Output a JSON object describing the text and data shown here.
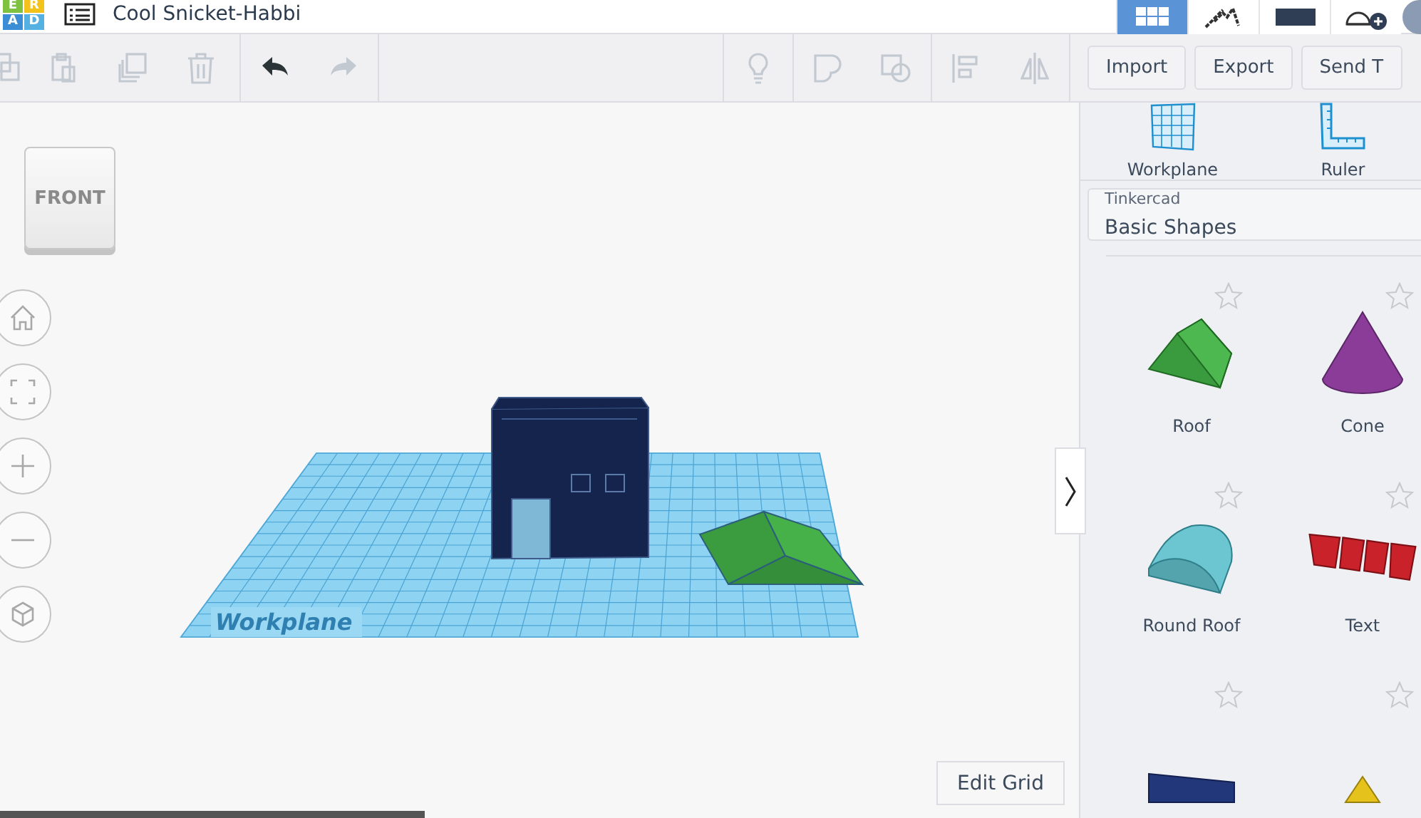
{
  "logo": {
    "letters": [
      "E",
      "R",
      "A",
      "D"
    ]
  },
  "design": {
    "title": "Cool Snicket-Habbi"
  },
  "view_modes": [
    {
      "kind": "grid",
      "selected": true
    },
    {
      "kind": "blocks",
      "selected": false
    },
    {
      "kind": "bricks",
      "selected": false
    },
    {
      "kind": "share",
      "selected": false
    }
  ],
  "toolbar": {
    "left": [
      {
        "kind": "copy",
        "disabled": true
      },
      {
        "kind": "paste",
        "disabled": true
      },
      {
        "kind": "duplicate",
        "disabled": true
      },
      {
        "kind": "delete",
        "disabled": true
      },
      {
        "kind": "undo",
        "disabled": false
      },
      {
        "kind": "redo",
        "disabled": true
      }
    ],
    "right": [
      {
        "kind": "bulb",
        "disabled": true
      },
      {
        "kind": "group",
        "disabled": true
      },
      {
        "kind": "ungroup",
        "disabled": true
      },
      {
        "kind": "align",
        "disabled": true
      },
      {
        "kind": "mirror",
        "disabled": true
      }
    ],
    "buttons": [
      "Import",
      "Export",
      "Send T"
    ]
  },
  "viewcube": {
    "face": "FRONT"
  },
  "nav": [
    {
      "kind": "home"
    },
    {
      "kind": "fit"
    },
    {
      "kind": "zoom_in"
    },
    {
      "kind": "zoom_out"
    },
    {
      "kind": "perspective"
    }
  ],
  "scene": {
    "workplane_label": "Workplane"
  },
  "edit_grid": "Edit Grid",
  "panel": {
    "tools": [
      {
        "kind": "workplane",
        "label": "Workplane"
      },
      {
        "kind": "ruler",
        "label": "Ruler"
      }
    ],
    "library": {
      "source": "Tinkercad",
      "name": "Basic Shapes"
    },
    "shapes": [
      {
        "kind": "roof",
        "label": "Roof"
      },
      {
        "kind": "cone",
        "label": "Cone"
      },
      {
        "kind": "round_roof",
        "label": "Round Roof"
      },
      {
        "kind": "text",
        "label": "Text"
      },
      {
        "kind": "box"
      },
      {
        "kind": "pyramid"
      }
    ]
  }
}
